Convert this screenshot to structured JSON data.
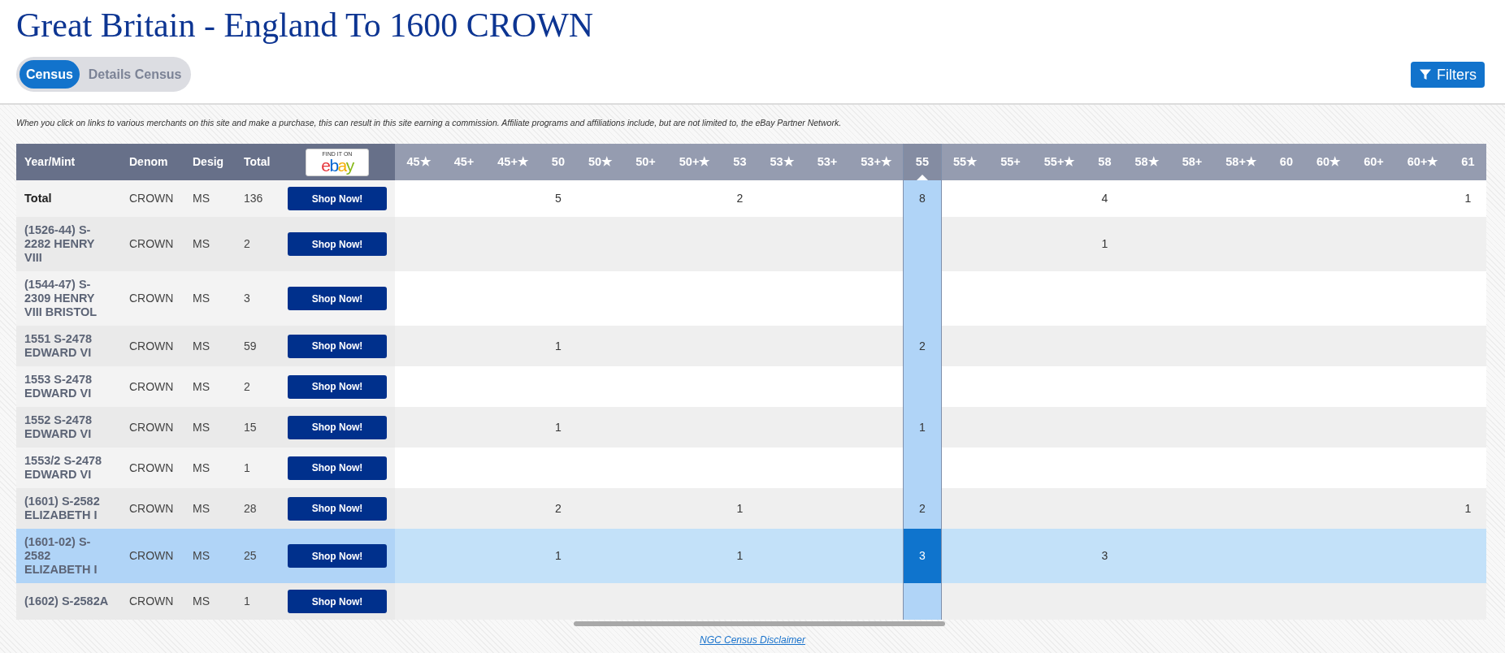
{
  "title": "Great Britain - England To 1600 CROWN",
  "view_tabs": [
    {
      "label": "Census",
      "selected": true
    },
    {
      "label": "Details Census",
      "selected": false
    }
  ],
  "filters_button": {
    "label": "Filters"
  },
  "affiliate_notice": "When you click on links to various merchants on this site and make a purchase, this can result in this site earning a commission. Affiliate programs and affiliations include, but are not limited to, the eBay Partner Network.",
  "table": {
    "columns": [
      "Year/Mint",
      "Denom",
      "Desig",
      "Total"
    ],
    "ebay_badge": {
      "caption": "FIND IT ON",
      "letters": [
        {
          "char": "e",
          "color": "#e53238"
        },
        {
          "char": "b",
          "color": "#0064d2"
        },
        {
          "char": "a",
          "color": "#f5af02"
        },
        {
          "char": "y",
          "color": "#86b817"
        }
      ]
    },
    "grades": [
      {
        "label": "45★",
        "selected": false
      },
      {
        "label": "45+",
        "selected": false
      },
      {
        "label": "45+★",
        "selected": false
      },
      {
        "label": "50",
        "selected": false
      },
      {
        "label": "50★",
        "selected": false
      },
      {
        "label": "50+",
        "selected": false
      },
      {
        "label": "50+★",
        "selected": false
      },
      {
        "label": "53",
        "selected": false
      },
      {
        "label": "53★",
        "selected": false
      },
      {
        "label": "53+",
        "selected": false
      },
      {
        "label": "53+★",
        "selected": false
      },
      {
        "label": "55",
        "selected": true
      },
      {
        "label": "55★",
        "selected": false
      },
      {
        "label": "55+",
        "selected": false
      },
      {
        "label": "55+★",
        "selected": false
      },
      {
        "label": "58",
        "selected": false
      },
      {
        "label": "58★",
        "selected": false
      },
      {
        "label": "58+",
        "selected": false
      },
      {
        "label": "58+★",
        "selected": false
      },
      {
        "label": "60",
        "selected": false
      },
      {
        "label": "60★",
        "selected": false
      },
      {
        "label": "60+",
        "selected": false
      },
      {
        "label": "60+★",
        "selected": false
      },
      {
        "label": "61",
        "selected": false
      }
    ],
    "rows": [
      {
        "kind": "total",
        "year_mint": "Total",
        "denom": "CROWN",
        "desig": "MS",
        "total": "136",
        "shop_button": "Shop Now!",
        "selected": false,
        "counts": [
          {
            "kind": "empty"
          },
          {
            "kind": "empty"
          },
          {
            "kind": "empty"
          },
          {
            "kind": "count",
            "value": "5"
          },
          {
            "kind": "empty"
          },
          {
            "kind": "empty"
          },
          {
            "kind": "empty"
          },
          {
            "kind": "count",
            "value": "2"
          },
          {
            "kind": "empty"
          },
          {
            "kind": "empty"
          },
          {
            "kind": "empty"
          },
          {
            "kind": "count",
            "value": "8"
          },
          {
            "kind": "empty"
          },
          {
            "kind": "empty"
          },
          {
            "kind": "empty"
          },
          {
            "kind": "count",
            "value": "4"
          },
          {
            "kind": "empty"
          },
          {
            "kind": "empty"
          },
          {
            "kind": "empty"
          },
          {
            "kind": "empty"
          },
          {
            "kind": "empty"
          },
          {
            "kind": "empty"
          },
          {
            "kind": "empty"
          },
          {
            "kind": "count",
            "value": "1"
          }
        ]
      },
      {
        "kind": "coin",
        "year_mint": "(1526-44) S-2282 HENRY VIII",
        "denom": "CROWN",
        "desig": "MS",
        "total": "2",
        "shop_button": "Shop Now!",
        "selected": false,
        "counts": [
          {
            "kind": "empty"
          },
          {
            "kind": "empty"
          },
          {
            "kind": "empty"
          },
          {
            "kind": "empty"
          },
          {
            "kind": "empty"
          },
          {
            "kind": "empty"
          },
          {
            "kind": "empty"
          },
          {
            "kind": "empty"
          },
          {
            "kind": "empty"
          },
          {
            "kind": "empty"
          },
          {
            "kind": "empty"
          },
          {
            "kind": "empty"
          },
          {
            "kind": "empty"
          },
          {
            "kind": "empty"
          },
          {
            "kind": "empty"
          },
          {
            "kind": "count",
            "value": "1"
          },
          {
            "kind": "empty"
          },
          {
            "kind": "empty"
          },
          {
            "kind": "empty"
          },
          {
            "kind": "empty"
          },
          {
            "kind": "empty"
          },
          {
            "kind": "empty"
          },
          {
            "kind": "empty"
          },
          {
            "kind": "empty"
          }
        ]
      },
      {
        "kind": "coin",
        "year_mint": "(1544-47) S-2309 HENRY VIII BRISTOL",
        "denom": "CROWN",
        "desig": "MS",
        "total": "3",
        "shop_button": "Shop Now!",
        "selected": false,
        "counts": [
          {
            "kind": "empty"
          },
          {
            "kind": "empty"
          },
          {
            "kind": "empty"
          },
          {
            "kind": "empty"
          },
          {
            "kind": "empty"
          },
          {
            "kind": "empty"
          },
          {
            "kind": "empty"
          },
          {
            "kind": "empty"
          },
          {
            "kind": "empty"
          },
          {
            "kind": "empty"
          },
          {
            "kind": "empty"
          },
          {
            "kind": "empty"
          },
          {
            "kind": "empty"
          },
          {
            "kind": "empty"
          },
          {
            "kind": "empty"
          },
          {
            "kind": "empty"
          },
          {
            "kind": "empty"
          },
          {
            "kind": "empty"
          },
          {
            "kind": "empty"
          },
          {
            "kind": "empty"
          },
          {
            "kind": "empty"
          },
          {
            "kind": "empty"
          },
          {
            "kind": "empty"
          },
          {
            "kind": "empty"
          }
        ]
      },
      {
        "kind": "coin",
        "year_mint": "1551 S-2478 EDWARD VI",
        "denom": "CROWN",
        "desig": "MS",
        "total": "59",
        "shop_button": "Shop Now!",
        "selected": false,
        "counts": [
          {
            "kind": "empty"
          },
          {
            "kind": "empty"
          },
          {
            "kind": "empty"
          },
          {
            "kind": "count",
            "value": "1"
          },
          {
            "kind": "empty"
          },
          {
            "kind": "empty"
          },
          {
            "kind": "empty"
          },
          {
            "kind": "empty"
          },
          {
            "kind": "empty"
          },
          {
            "kind": "empty"
          },
          {
            "kind": "empty"
          },
          {
            "kind": "count",
            "value": "2"
          },
          {
            "kind": "empty"
          },
          {
            "kind": "empty"
          },
          {
            "kind": "empty"
          },
          {
            "kind": "empty"
          },
          {
            "kind": "empty"
          },
          {
            "kind": "empty"
          },
          {
            "kind": "empty"
          },
          {
            "kind": "empty"
          },
          {
            "kind": "empty"
          },
          {
            "kind": "empty"
          },
          {
            "kind": "empty"
          },
          {
            "kind": "empty"
          }
        ]
      },
      {
        "kind": "coin",
        "year_mint": "1553 S-2478 EDWARD VI",
        "denom": "CROWN",
        "desig": "MS",
        "total": "2",
        "shop_button": "Shop Now!",
        "selected": false,
        "counts": [
          {
            "kind": "empty"
          },
          {
            "kind": "empty"
          },
          {
            "kind": "empty"
          },
          {
            "kind": "empty"
          },
          {
            "kind": "empty"
          },
          {
            "kind": "empty"
          },
          {
            "kind": "empty"
          },
          {
            "kind": "empty"
          },
          {
            "kind": "empty"
          },
          {
            "kind": "empty"
          },
          {
            "kind": "empty"
          },
          {
            "kind": "empty"
          },
          {
            "kind": "empty"
          },
          {
            "kind": "empty"
          },
          {
            "kind": "empty"
          },
          {
            "kind": "empty"
          },
          {
            "kind": "empty"
          },
          {
            "kind": "empty"
          },
          {
            "kind": "empty"
          },
          {
            "kind": "empty"
          },
          {
            "kind": "empty"
          },
          {
            "kind": "empty"
          },
          {
            "kind": "empty"
          },
          {
            "kind": "empty"
          }
        ]
      },
      {
        "kind": "coin",
        "year_mint": "1552 S-2478 EDWARD VI",
        "denom": "CROWN",
        "desig": "MS",
        "total": "15",
        "shop_button": "Shop Now!",
        "selected": false,
        "counts": [
          {
            "kind": "empty"
          },
          {
            "kind": "empty"
          },
          {
            "kind": "empty"
          },
          {
            "kind": "count",
            "value": "1"
          },
          {
            "kind": "empty"
          },
          {
            "kind": "empty"
          },
          {
            "kind": "empty"
          },
          {
            "kind": "empty"
          },
          {
            "kind": "empty"
          },
          {
            "kind": "empty"
          },
          {
            "kind": "empty"
          },
          {
            "kind": "count",
            "value": "1"
          },
          {
            "kind": "empty"
          },
          {
            "kind": "empty"
          },
          {
            "kind": "empty"
          },
          {
            "kind": "empty"
          },
          {
            "kind": "empty"
          },
          {
            "kind": "empty"
          },
          {
            "kind": "empty"
          },
          {
            "kind": "empty"
          },
          {
            "kind": "empty"
          },
          {
            "kind": "empty"
          },
          {
            "kind": "empty"
          },
          {
            "kind": "empty"
          }
        ]
      },
      {
        "kind": "coin",
        "year_mint": "1553/2 S-2478 EDWARD VI",
        "denom": "CROWN",
        "desig": "MS",
        "total": "1",
        "shop_button": "Shop Now!",
        "selected": false,
        "counts": [
          {
            "kind": "empty"
          },
          {
            "kind": "empty"
          },
          {
            "kind": "empty"
          },
          {
            "kind": "empty"
          },
          {
            "kind": "empty"
          },
          {
            "kind": "empty"
          },
          {
            "kind": "empty"
          },
          {
            "kind": "empty"
          },
          {
            "kind": "empty"
          },
          {
            "kind": "empty"
          },
          {
            "kind": "empty"
          },
          {
            "kind": "empty"
          },
          {
            "kind": "empty"
          },
          {
            "kind": "empty"
          },
          {
            "kind": "empty"
          },
          {
            "kind": "empty"
          },
          {
            "kind": "empty"
          },
          {
            "kind": "empty"
          },
          {
            "kind": "empty"
          },
          {
            "kind": "empty"
          },
          {
            "kind": "empty"
          },
          {
            "kind": "empty"
          },
          {
            "kind": "empty"
          },
          {
            "kind": "empty"
          }
        ]
      },
      {
        "kind": "coin",
        "year_mint": "(1601) S-2582 ELIZABETH I",
        "denom": "CROWN",
        "desig": "MS",
        "total": "28",
        "shop_button": "Shop Now!",
        "selected": false,
        "counts": [
          {
            "kind": "empty"
          },
          {
            "kind": "empty"
          },
          {
            "kind": "empty"
          },
          {
            "kind": "count",
            "value": "2"
          },
          {
            "kind": "empty"
          },
          {
            "kind": "empty"
          },
          {
            "kind": "empty"
          },
          {
            "kind": "count",
            "value": "1"
          },
          {
            "kind": "empty"
          },
          {
            "kind": "empty"
          },
          {
            "kind": "empty"
          },
          {
            "kind": "count",
            "value": "2"
          },
          {
            "kind": "empty"
          },
          {
            "kind": "empty"
          },
          {
            "kind": "empty"
          },
          {
            "kind": "empty"
          },
          {
            "kind": "empty"
          },
          {
            "kind": "empty"
          },
          {
            "kind": "empty"
          },
          {
            "kind": "empty"
          },
          {
            "kind": "empty"
          },
          {
            "kind": "empty"
          },
          {
            "kind": "empty"
          },
          {
            "kind": "count",
            "value": "1"
          }
        ]
      },
      {
        "kind": "coin",
        "year_mint": "(1601-02) S-2582 ELIZABETH I",
        "denom": "CROWN",
        "desig": "MS",
        "total": "25",
        "shop_button": "Shop Now!",
        "selected": true,
        "counts": [
          {
            "kind": "empty"
          },
          {
            "kind": "empty"
          },
          {
            "kind": "empty"
          },
          {
            "kind": "count",
            "value": "1"
          },
          {
            "kind": "empty"
          },
          {
            "kind": "empty"
          },
          {
            "kind": "empty"
          },
          {
            "kind": "count",
            "value": "1"
          },
          {
            "kind": "empty"
          },
          {
            "kind": "empty"
          },
          {
            "kind": "empty"
          },
          {
            "kind": "count",
            "value": "3"
          },
          {
            "kind": "empty"
          },
          {
            "kind": "empty"
          },
          {
            "kind": "empty"
          },
          {
            "kind": "count",
            "value": "3"
          },
          {
            "kind": "empty"
          },
          {
            "kind": "empty"
          },
          {
            "kind": "empty"
          },
          {
            "kind": "empty"
          },
          {
            "kind": "empty"
          },
          {
            "kind": "empty"
          },
          {
            "kind": "empty"
          },
          {
            "kind": "empty"
          }
        ]
      },
      {
        "kind": "coin",
        "year_mint": "(1602) S-2582A",
        "denom": "CROWN",
        "desig": "MS",
        "total": "1",
        "shop_button": "Shop Now!",
        "selected": false,
        "counts": [
          {
            "kind": "empty"
          },
          {
            "kind": "empty"
          },
          {
            "kind": "empty"
          },
          {
            "kind": "empty"
          },
          {
            "kind": "empty"
          },
          {
            "kind": "empty"
          },
          {
            "kind": "empty"
          },
          {
            "kind": "empty"
          },
          {
            "kind": "empty"
          },
          {
            "kind": "empty"
          },
          {
            "kind": "empty"
          },
          {
            "kind": "empty"
          },
          {
            "kind": "empty"
          },
          {
            "kind": "empty"
          },
          {
            "kind": "empty"
          },
          {
            "kind": "empty"
          },
          {
            "kind": "empty"
          },
          {
            "kind": "empty"
          },
          {
            "kind": "empty"
          },
          {
            "kind": "empty"
          },
          {
            "kind": "empty"
          },
          {
            "kind": "empty"
          },
          {
            "kind": "empty"
          },
          {
            "kind": "empty"
          }
        ]
      }
    ]
  },
  "footer_link": "NGC Census Disclaimer"
}
